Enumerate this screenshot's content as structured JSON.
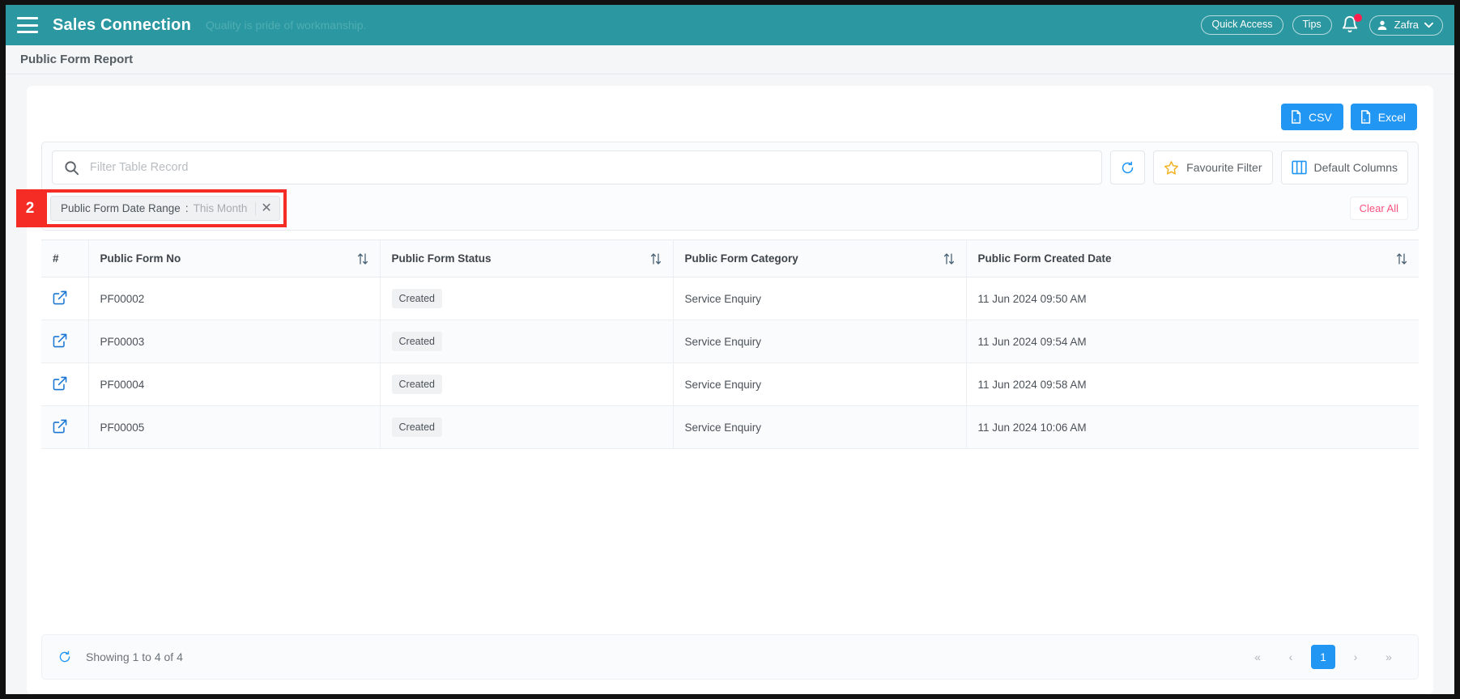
{
  "topbar": {
    "menu_icon": "hamburger-icon",
    "brand": "Sales Connection",
    "tagline": "Quality is pride of workmanship.",
    "quick_access": "Quick Access",
    "tips": "Tips",
    "notification_icon": "bell-icon",
    "user_name": "Zafra",
    "brand_color": "#2b97a0",
    "badge_color": "#ff1f4e"
  },
  "page": {
    "title": "Public Form Report"
  },
  "export": {
    "csv_label": "CSV",
    "excel_label": "Excel",
    "csv_icon": "csv-file-icon",
    "excel_icon": "excel-file-icon",
    "button_color": "#2196f3"
  },
  "toolbar": {
    "search_placeholder": "Filter Table Record",
    "search_value": "",
    "search_icon": "search-icon",
    "refresh_icon": "refresh-icon",
    "favourite_filter_label": "Favourite Filter",
    "favourite_filter_icon": "star-icon",
    "default_columns_label": "Default Columns",
    "default_columns_icon": "columns-icon"
  },
  "filters": {
    "chips": [
      {
        "label": "Public Form Date Range",
        "separator": ":",
        "value": "This Month",
        "remove_icon": "close-icon"
      }
    ],
    "clear_all_label": "Clear All",
    "clear_all_color": "#f8517e"
  },
  "annotation": {
    "number": "2",
    "color": "#f52b25"
  },
  "table": {
    "columns": [
      {
        "label": "#",
        "sortable": false
      },
      {
        "label": "Public Form No",
        "sortable": true
      },
      {
        "label": "Public Form Status",
        "sortable": true
      },
      {
        "label": "Public Form Category",
        "sortable": true
      },
      {
        "label": "Public Form Created Date",
        "sortable": true
      }
    ],
    "sort_icon": "sort-updown-icon",
    "row_action_icon": "external-link-icon",
    "rows": [
      {
        "form_no": "PF00002",
        "status": "Created",
        "category": "Service Enquiry",
        "created_date": "11 Jun 2024 09:50 AM"
      },
      {
        "form_no": "PF00003",
        "status": "Created",
        "category": "Service Enquiry",
        "created_date": "11 Jun 2024 09:54 AM"
      },
      {
        "form_no": "PF00004",
        "status": "Created",
        "category": "Service Enquiry",
        "created_date": "11 Jun 2024 09:58 AM"
      },
      {
        "form_no": "PF00005",
        "status": "Created",
        "category": "Service Enquiry",
        "created_date": "11 Jun 2024 10:06 AM"
      }
    ]
  },
  "footer": {
    "refresh_icon": "refresh-icon",
    "showing_text": "Showing 1 to 4 of 4",
    "pagination": {
      "first": "«",
      "prev": "‹",
      "current_page": "1",
      "next": "›",
      "last": "»",
      "active_color": "#2196f3"
    }
  }
}
